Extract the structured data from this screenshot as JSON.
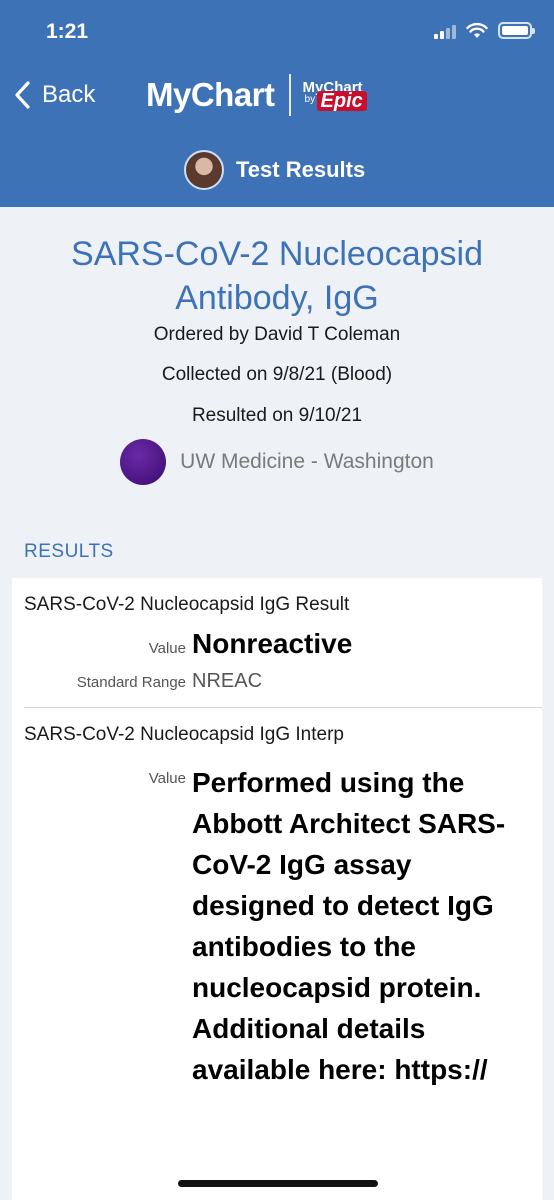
{
  "status_bar": {
    "time": "1:21"
  },
  "nav": {
    "back_label": "Back",
    "brand": "MyChart",
    "brand_sub_top": "MyChart",
    "brand_sub_by": "by",
    "brand_sub_epic": "Epic"
  },
  "page_tab": {
    "label": "Test Results"
  },
  "test": {
    "title": "SARS-CoV-2 Nucleocapsid Antibody, IgG",
    "ordered_by": "Ordered by David T Coleman",
    "collected": "Collected on 9/8/21 (Blood)",
    "resulted": "Resulted on 9/10/21",
    "organization": "UW Medicine - Washington"
  },
  "results_section": {
    "label": "RESULTS",
    "components": [
      {
        "name": "SARS-CoV-2 Nucleocapsid IgG Result",
        "value_label": "Value",
        "value": "Nonreactive",
        "range_label": "Standard Range",
        "range": "NREAC"
      },
      {
        "name": "SARS-CoV-2 Nucleocapsid IgG Interp",
        "value_label": "Value",
        "value": "Performed using the Abbott Architect SARS-CoV-2 IgG assay designed to detect IgG antibodies to the nucleocapsid protein. Additional details available here: https://"
      }
    ]
  },
  "colors": {
    "header": "#3e72b7",
    "accent": "#3e72b7",
    "org_logo": "#4b127f"
  }
}
